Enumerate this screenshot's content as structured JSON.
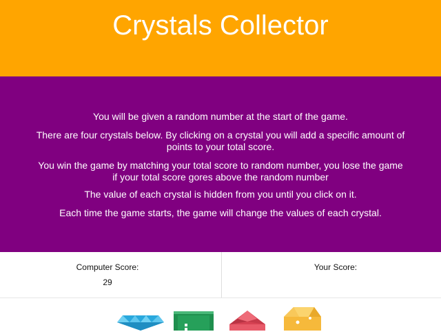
{
  "header": {
    "title": "Crystals Collector",
    "background": "#ffa500"
  },
  "instructions": {
    "background": "#800080",
    "lines": [
      "You will be given a random number at the start of the game.",
      "There are four crystals below. By clicking on a crystal you will add a specific amount of points to your total score.",
      "You win the game by matching your total score to random number, you lose the game if your total score gores above the random number",
      "The value of each crystal is hidden from you until you click on it.",
      "Each time the game starts, the game will change the values of each crystal."
    ]
  },
  "scores": {
    "computer_label": "Computer Score:",
    "computer_value": "29",
    "user_label": "Your Score:",
    "user_value": ""
  },
  "crystals": [
    {
      "name": "blue-crystal-icon",
      "color": "#29a8dd"
    },
    {
      "name": "green-crystal-icon",
      "color": "#1f8f4e"
    },
    {
      "name": "red-crystal-icon",
      "color": "#d64253"
    },
    {
      "name": "yellow-crystal-icon",
      "color": "#f6b93b"
    }
  ]
}
